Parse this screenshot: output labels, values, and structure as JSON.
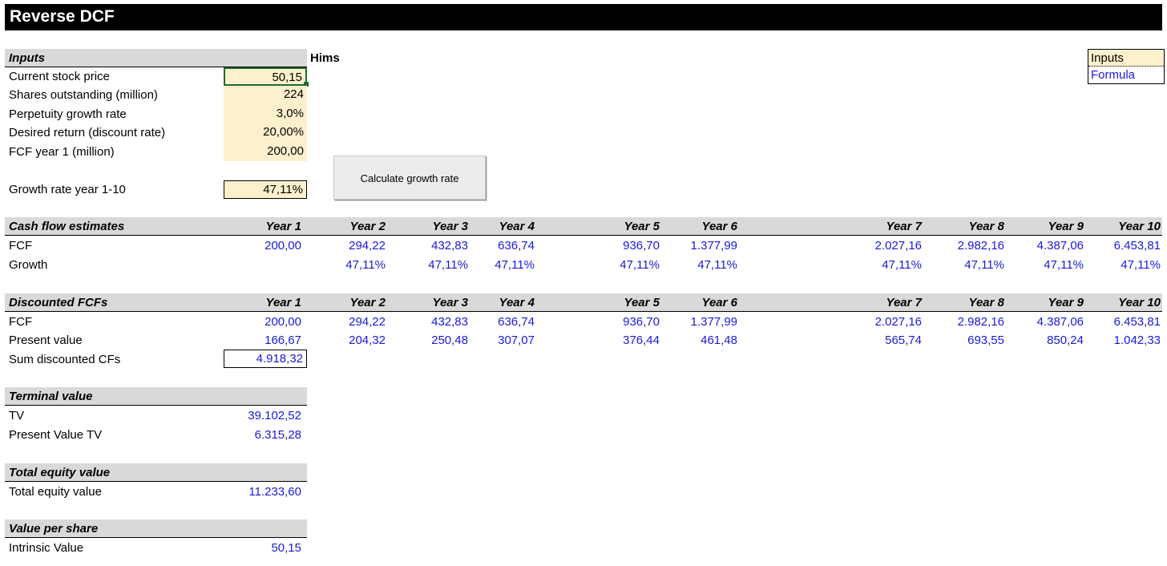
{
  "title": "Reverse DCF",
  "company": "Hims",
  "legend": {
    "inputs": "Inputs",
    "formula": "Formula"
  },
  "button_label": "Calculate growth rate",
  "inputs": {
    "header": "Inputs",
    "rows": [
      {
        "label": "Current stock price",
        "value": "50,15"
      },
      {
        "label": "Shares outstanding (million)",
        "value": "224"
      },
      {
        "label": "Perpetuity growth rate",
        "value": "3,0%"
      },
      {
        "label": "Desired return (discount rate)",
        "value": "20,00%"
      },
      {
        "label": "FCF year 1 (million)",
        "value": "200,00"
      }
    ],
    "growth_label": "Growth rate year 1-10",
    "growth_value": "47,11%"
  },
  "years": [
    "Year 1",
    "Year 2",
    "Year 3",
    "Year 4",
    "Year 5",
    "Year 6",
    "Year 7",
    "Year 8",
    "Year 9",
    "Year 10"
  ],
  "cash_flow": {
    "header": "Cash flow estimates",
    "fcf_label": "FCF",
    "fcf": [
      "200,00",
      "294,22",
      "432,83",
      "636,74",
      "936,70",
      "1.377,99",
      "2.027,16",
      "2.982,16",
      "4.387,06",
      "6.453,81"
    ],
    "growth_label": "Growth",
    "growth": [
      "",
      "47,11%",
      "47,11%",
      "47,11%",
      "47,11%",
      "47,11%",
      "47,11%",
      "47,11%",
      "47,11%",
      "47,11%"
    ]
  },
  "discounted": {
    "header": "Discounted FCFs",
    "fcf_label": "FCF",
    "fcf": [
      "200,00",
      "294,22",
      "432,83",
      "636,74",
      "936,70",
      "1.377,99",
      "2.027,16",
      "2.982,16",
      "4.387,06",
      "6.453,81"
    ],
    "pv_label": "Present value",
    "pv": [
      "166,67",
      "204,32",
      "250,48",
      "307,07",
      "376,44",
      "461,48",
      "565,74",
      "693,55",
      "850,24",
      "1.042,33"
    ],
    "sum_label": "Sum discounted CFs",
    "sum_value": "4.918,32"
  },
  "terminal": {
    "header": "Terminal value",
    "tv_label": "TV",
    "tv_value": "39.102,52",
    "pvtv_label": "Present Value TV",
    "pvtv_value": "6.315,28"
  },
  "equity": {
    "header": "Total equity value",
    "label": "Total equity value",
    "value": "11.233,60"
  },
  "per_share": {
    "header": "Value per share",
    "label": "Intrinsic Value",
    "value": "50,15"
  },
  "colors": {
    "input_fill": "#fdf1cd",
    "formula_text": "#1a1ad6",
    "header_fill": "#d9d9d9",
    "selected_border": "#1e6b35"
  }
}
